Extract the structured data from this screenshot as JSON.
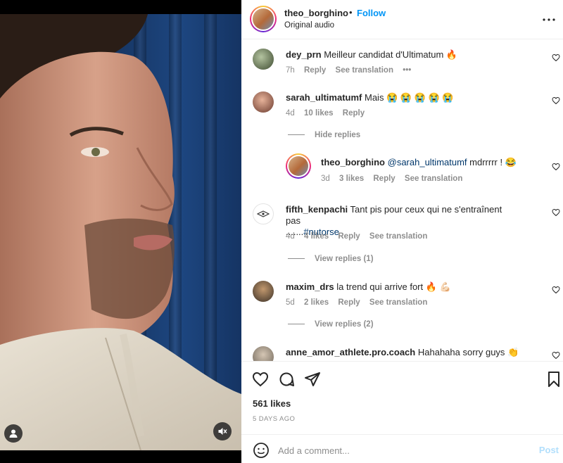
{
  "post": {
    "username": "theo_borghino",
    "separator": "•",
    "follow_label": "Follow",
    "subtitle": "Original audio",
    "more_icon": "more-horizontal-icon"
  },
  "comments": [
    {
      "username": "dey_prn",
      "text": "Meilleur candidat d'Ultimatum 🔥",
      "time": "7h",
      "likes": "",
      "reply": "Reply",
      "see_translation": "See translation",
      "more": "•••"
    },
    {
      "username": "sarah_ultimatumf",
      "text": "Mais 😭 😭 😭 😭 😭",
      "time": "4d",
      "likes": "10 likes",
      "reply": "Reply",
      "toggle": "Hide replies"
    },
    {
      "username": "theo_borghino",
      "mention": "@sarah_ultimatumf",
      "text": " mdrrrrr ! 😂",
      "time": "3d",
      "likes": "3 likes",
      "reply": "Reply",
      "see_translation": "See translation"
    },
    {
      "username": "fifth_kenpachi",
      "text": "Tant pis pour ceux qui ne s'entraînent pas",
      "text2_prefix": ".......",
      "hashtag": "#nutorse",
      "time": "4d",
      "likes": "4 likes",
      "reply": "Reply",
      "see_translation": "See translation",
      "toggle": "View replies (1)"
    },
    {
      "username": "maxim_drs",
      "text": "la trend qui arrive fort 🔥 💪🏻",
      "time": "5d",
      "likes": "2 likes",
      "reply": "Reply",
      "see_translation": "See translation",
      "toggle": "View replies (2)"
    },
    {
      "username": "anne_amor_athlete.pro.coach",
      "text": "Hahahaha sorry guys 👏"
    }
  ],
  "actions": {
    "like_icon": "heart-icon",
    "comment_icon": "comment-icon",
    "share_icon": "share-icon",
    "save_icon": "bookmark-icon",
    "likes": "561 likes",
    "date": "5 DAYS AGO"
  },
  "composer": {
    "placeholder": "Add a comment...",
    "post_label": "Post"
  },
  "colors": {
    "accent": "#0095f6",
    "post_disabled": "#b2dffc",
    "muted": "#8e8e8e",
    "text": "#262626"
  }
}
